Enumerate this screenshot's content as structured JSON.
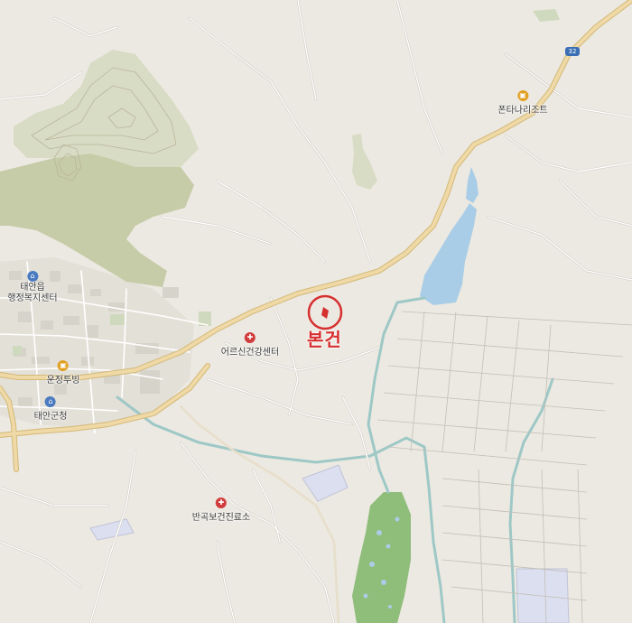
{
  "map": {
    "colors": {
      "land": "#ece9e2",
      "forest_light": "#d9dcc4",
      "forest_dark": "#c7cca8",
      "contour": "#b8b59a",
      "water": "#a9cde6",
      "river": "#9ec8c6",
      "road_main": "#efd9a6",
      "road_main_edge": "#d3b878",
      "road_minor": "#ffffff",
      "road_minor_edge": "#c9c5bb",
      "field_line": "#c2bfb6",
      "urban": "#dcd9d2",
      "marker": "#d62f2f"
    }
  },
  "target": {
    "label": "본건",
    "color": "#d62f2f"
  },
  "route_shield": {
    "number": "32"
  },
  "pois": [
    {
      "id": "taean-eup-office",
      "name": "태안읍\n행정복지센터",
      "icon": "government-office-icon",
      "color": "#4a7ac0"
    },
    {
      "id": "county-office",
      "name": "태안군청",
      "icon": "government-office-icon",
      "color": "#4a7ac0"
    },
    {
      "id": "hotel",
      "name": "운정투빙",
      "icon": "lodging-icon",
      "color": "#e0a020"
    },
    {
      "id": "resort",
      "name": "폰타나리조트",
      "icon": "lodging-icon",
      "color": "#e0a020"
    },
    {
      "id": "elder-health",
      "name": "어르신건강센터",
      "icon": "hospital-icon",
      "color": "#d23b3b"
    },
    {
      "id": "clinic",
      "name": "반곡보건진료소",
      "icon": "hospital-icon",
      "color": "#d23b3b"
    }
  ]
}
